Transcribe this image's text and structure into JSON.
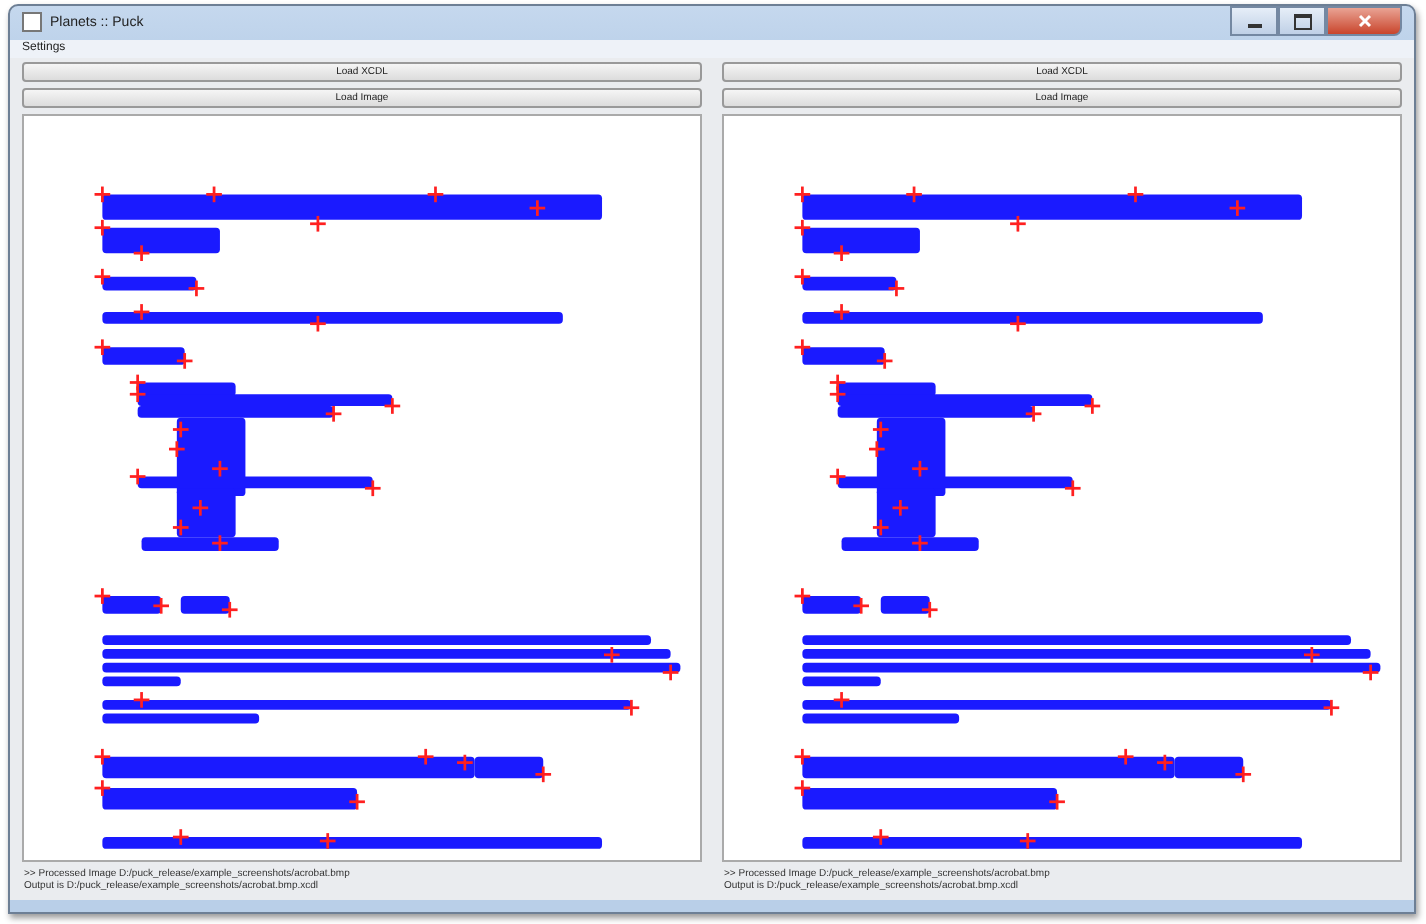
{
  "window": {
    "title": "Planets :: Puck"
  },
  "menu": [
    "Settings"
  ],
  "panels": [
    {
      "buttons": [
        "Load XCDL",
        "Load Image"
      ],
      "log": [
        ">> Processed Image D:/puck_release/example_screenshots/acrobat.bmp",
        "Output is D:/puck_release/example_screenshots/acrobat.bmp.xcdl"
      ]
    },
    {
      "buttons": [
        "Load XCDL",
        "Load Image"
      ],
      "log": [
        ">> Processed Image D:/puck_release/example_screenshots/acrobat.bmp",
        "Output is D:/puck_release/example_screenshots/acrobat.bmp.xcdl"
      ]
    }
  ]
}
